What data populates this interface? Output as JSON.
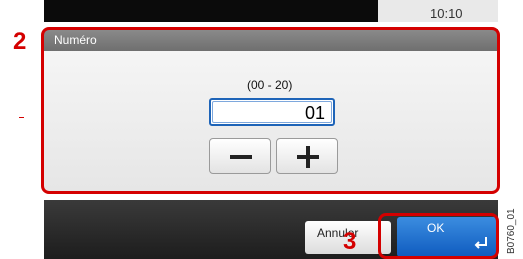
{
  "status_bar": {
    "clock": "10:10"
  },
  "dialog": {
    "title": "Numéro",
    "range": "(00 - 20)",
    "value": "01"
  },
  "buttons": {
    "cancel_label": "Annuler",
    "ok_label": "OK"
  },
  "annotations": {
    "step_2": "2",
    "step_3": "3",
    "figure_code": "B0760_01",
    "highlight_color": "#d40000"
  }
}
